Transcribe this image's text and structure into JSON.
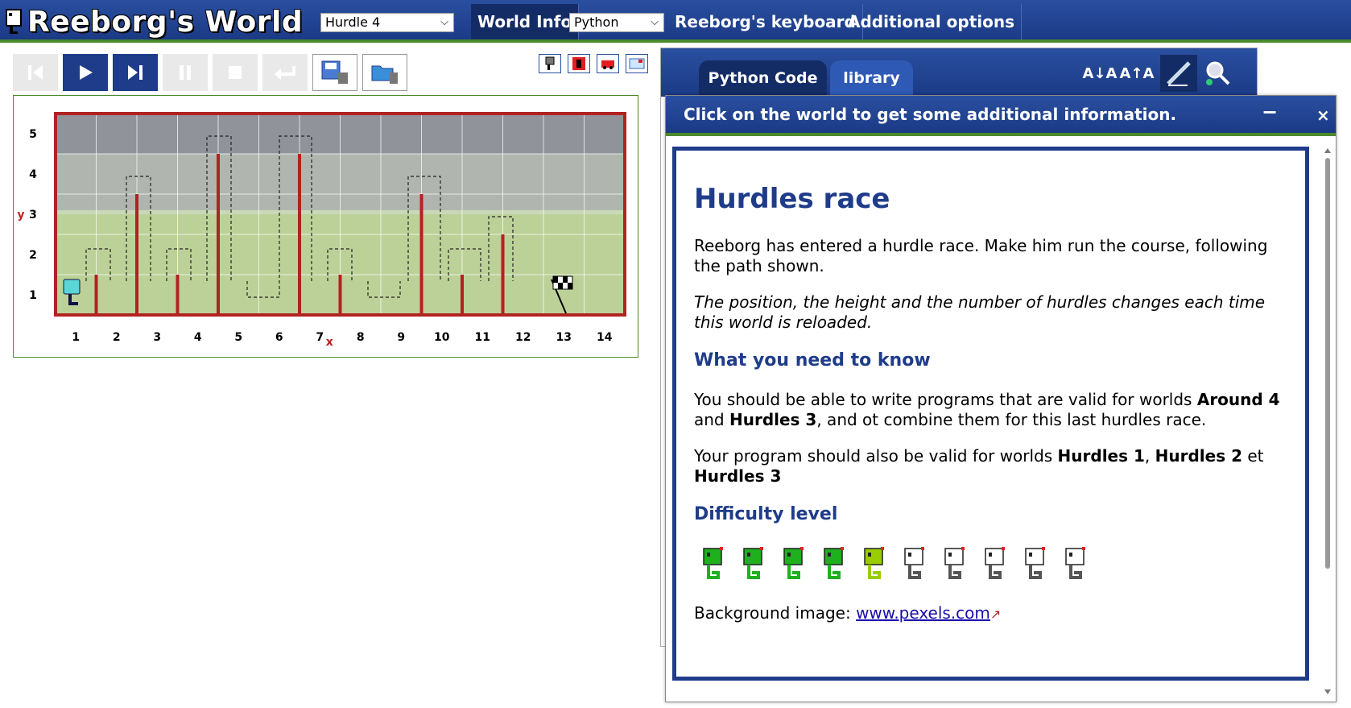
{
  "app": {
    "title": "Reeborg's World"
  },
  "topbar": {
    "world_select": "Hurdle 4",
    "language_select": "Python",
    "nav": {
      "world_info": "World Info",
      "keyboard": "Reeborg's keyboard",
      "options": "Additional options"
    }
  },
  "controls": [
    "reverse-step",
    "run",
    "step",
    "pause",
    "stop",
    "reload",
    "save",
    "open"
  ],
  "world": {
    "x_ticks": [
      "1",
      "2",
      "3",
      "4",
      "5",
      "6",
      "7",
      "8",
      "9",
      "10",
      "11",
      "12",
      "13",
      "14"
    ],
    "y_ticks": [
      "1",
      "2",
      "3",
      "4",
      "5"
    ],
    "x_axis_label": "x",
    "y_axis_label": "y",
    "hurdle_color": "#b22222"
  },
  "editor": {
    "tabs": [
      "Python Code",
      "library"
    ],
    "font_decrease": "A↓A",
    "font_increase": "A↑A"
  },
  "info": {
    "bar_text": "Click on the world to get some additional information.",
    "minimize": "−",
    "close": "×",
    "title": "Hurdles race",
    "p1": "Reeborg has entered a hurdle race. Make him run the course, following the path shown.",
    "p2": "The position, the height and the number of hurdles changes each time this world is reloaded.",
    "h_need": "What you need to know",
    "p3_a": "You should be able to write programs that are valid for worlds ",
    "p3_b": "Around 4",
    "p3_c": " and ",
    "p3_d": "Hurdles 3",
    "p3_e": ", and ot combine them for this last hurdles race.",
    "p4_a": "Your program should also be valid for worlds ",
    "p4_b": "Hurdles 1",
    "p4_c": ", ",
    "p4_d": "Hurdles 2",
    "p4_e": " et ",
    "p4_f": "Hurdles 3",
    "h_diff": "Difficulty level",
    "difficulty_level": 5,
    "difficulty_max": 10,
    "bg_label": "Background image: ",
    "bg_link": "www.pexels.com"
  }
}
